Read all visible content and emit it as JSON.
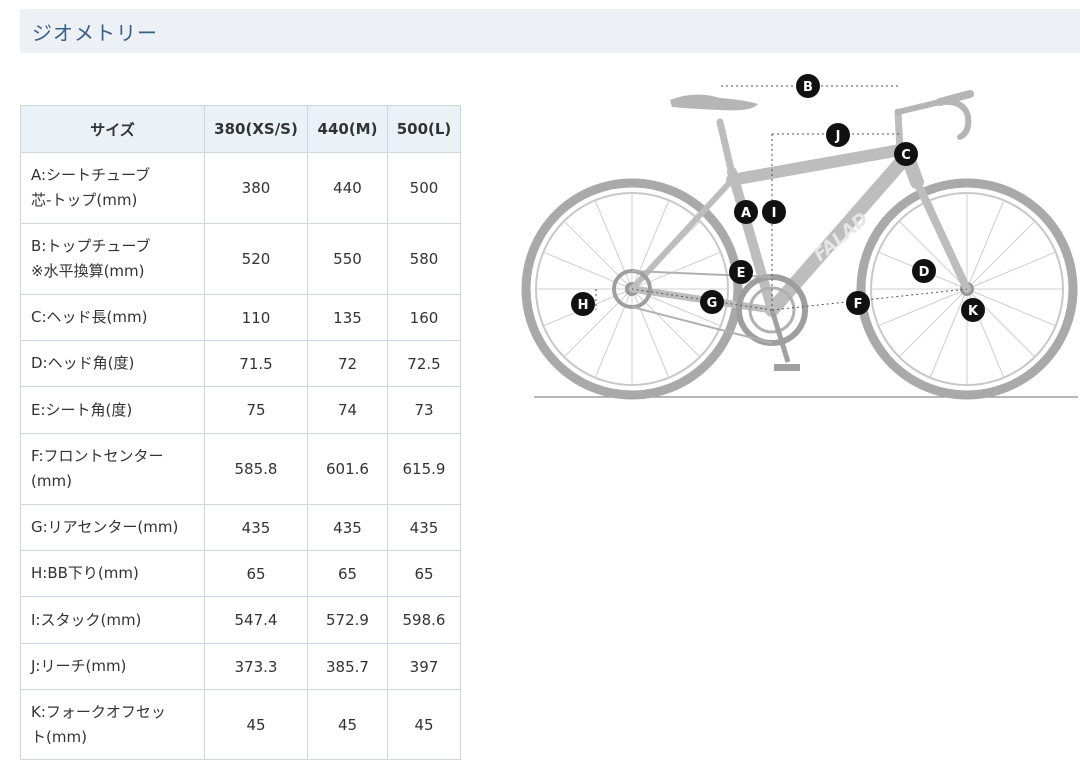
{
  "title": "ジオメトリー",
  "table": {
    "columns": [
      "サイズ",
      "380(XS/S)",
      "440(M)",
      "500(L)"
    ],
    "rows": [
      {
        "label1": "A:シートチューブ",
        "label2": "芯-トップ(mm)",
        "values": [
          "380",
          "440",
          "500"
        ]
      },
      {
        "label1": "B:トップチューブ",
        "label2": "※水平換算(mm)",
        "values": [
          "520",
          "550",
          "580"
        ]
      },
      {
        "label1": "C:ヘッド長(mm)",
        "label2": "",
        "values": [
          "110",
          "135",
          "160"
        ]
      },
      {
        "label1": "D:ヘッド角(度)",
        "label2": "",
        "values": [
          "71.5",
          "72",
          "72.5"
        ]
      },
      {
        "label1": "E:シート角(度)",
        "label2": "",
        "values": [
          "75",
          "74",
          "73"
        ]
      },
      {
        "label1": "F:フロントセンター",
        "label2": "(mm)",
        "values": [
          "585.8",
          "601.6",
          "615.9"
        ]
      },
      {
        "label1": "G:リアセンター(mm)",
        "label2": "",
        "values": [
          "435",
          "435",
          "435"
        ]
      },
      {
        "label1": "H:BB下り(mm)",
        "label2": "",
        "values": [
          "65",
          "65",
          "65"
        ]
      },
      {
        "label1": "I:スタック(mm)",
        "label2": "",
        "values": [
          "547.4",
          "572.9",
          "598.6"
        ]
      },
      {
        "label1": "J:リーチ(mm)",
        "label2": "",
        "values": [
          "373.3",
          "385.7",
          "397"
        ]
      },
      {
        "label1": "K:フォークオフセッ",
        "label2": "ト(mm)",
        "values": [
          "45",
          "45",
          "45"
        ]
      }
    ]
  },
  "diagram": {
    "markers": [
      "A",
      "B",
      "C",
      "D",
      "E",
      "F",
      "G",
      "H",
      "I",
      "J",
      "K"
    ],
    "frame_text": "FALAD",
    "colors": {
      "frame": "#bdbdbd",
      "wheel": "#a9a9a9",
      "marker": "#111111",
      "header_bg": "#edf0f4",
      "title": "#3a5f86"
    }
  }
}
